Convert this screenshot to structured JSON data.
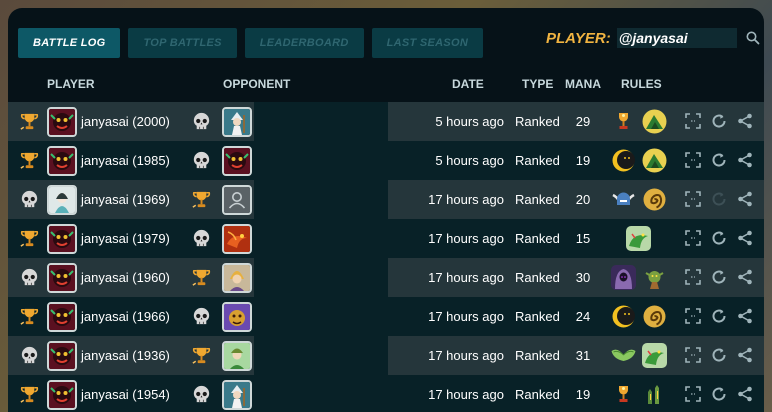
{
  "nav": {
    "tabs": [
      {
        "label": "BATTLE LOG",
        "active": true
      },
      {
        "label": "TOP BATTLES",
        "active": false
      },
      {
        "label": "LEADERBOARD",
        "active": false
      },
      {
        "label": "LAST SEASON",
        "active": false
      }
    ]
  },
  "search": {
    "label": "PLAYER:",
    "value": "@janyasai"
  },
  "columns": {
    "player": "PLAYER",
    "opponent": "OPPONENT",
    "date": "DATE",
    "type": "TYPE",
    "mana": "MANA",
    "rules": "RULES"
  },
  "colors": {
    "accent": "#0d5866",
    "player_label": "#f1b441",
    "row_odd": "#25363b",
    "row_even": "#082127"
  },
  "rows": [
    {
      "result_icon": "trophy-icon",
      "avatar": "fire-demon",
      "player": "janyasai (2000)",
      "opp_result": "skull-icon",
      "opp_avatar": "white-wizard",
      "date": "5 hours ago",
      "type": "Ranked",
      "mana": "29",
      "rules": [
        "gold-trophy-rule",
        "green-hill-rule"
      ],
      "rematch_enabled": true
    },
    {
      "result_icon": "trophy-icon",
      "avatar": "fire-demon",
      "player": "janyasai (1985)",
      "opp_result": "skull-icon",
      "opp_avatar": "fire-demon",
      "date": "5 hours ago",
      "type": "Ranked",
      "mana": "19",
      "rules": [
        "eclipse-rule",
        "green-hill-rule"
      ],
      "rematch_enabled": true
    },
    {
      "result_icon": "skull-icon",
      "avatar": "pale-lady",
      "player": "janyasai (1969)",
      "opp_result": "trophy-icon",
      "opp_avatar": "empty-avatar",
      "date": "17 hours ago",
      "type": "Ranked",
      "mana": "20",
      "rules": [
        "winged-helm-rule",
        "spiral-rule"
      ],
      "rematch_enabled": false
    },
    {
      "result_icon": "trophy-icon",
      "avatar": "fire-demon",
      "player": "janyasai (1979)",
      "opp_result": "skull-icon",
      "opp_avatar": "red-dragon",
      "date": "17 hours ago",
      "type": "Ranked",
      "mana": "15",
      "rules": [
        "green-dragon-rule"
      ],
      "rematch_enabled": true
    },
    {
      "result_icon": "skull-icon",
      "avatar": "fire-demon",
      "player": "janyasai (1960)",
      "opp_result": "trophy-icon",
      "opp_avatar": "blonde-knight",
      "date": "17 hours ago",
      "type": "Ranked",
      "mana": "30",
      "rules": [
        "hooded-rule",
        "goblin-rule"
      ],
      "rematch_enabled": true
    },
    {
      "result_icon": "trophy-icon",
      "avatar": "fire-demon",
      "player": "janyasai (1966)",
      "opp_result": "skull-icon",
      "opp_avatar": "golden-beast",
      "date": "17 hours ago",
      "type": "Ranked",
      "mana": "24",
      "rules": [
        "eclipse-rule",
        "spiral-rule"
      ],
      "rematch_enabled": true
    },
    {
      "result_icon": "skull-icon",
      "avatar": "fire-demon",
      "player": "janyasai (1936)",
      "opp_result": "trophy-icon",
      "opp_avatar": "green-elf",
      "date": "17 hours ago",
      "type": "Ranked",
      "mana": "31",
      "rules": [
        "wings-rule",
        "green-dragon-rule"
      ],
      "rematch_enabled": true
    },
    {
      "result_icon": "trophy-icon",
      "avatar": "fire-demon",
      "player": "janyasai (1954)",
      "opp_result": "skull-icon",
      "opp_avatar": "white-wizard",
      "date": "17 hours ago",
      "type": "Ranked",
      "mana": "19",
      "rules": [
        "gold-trophy-rule",
        "forest-rule"
      ],
      "rematch_enabled": true
    }
  ]
}
